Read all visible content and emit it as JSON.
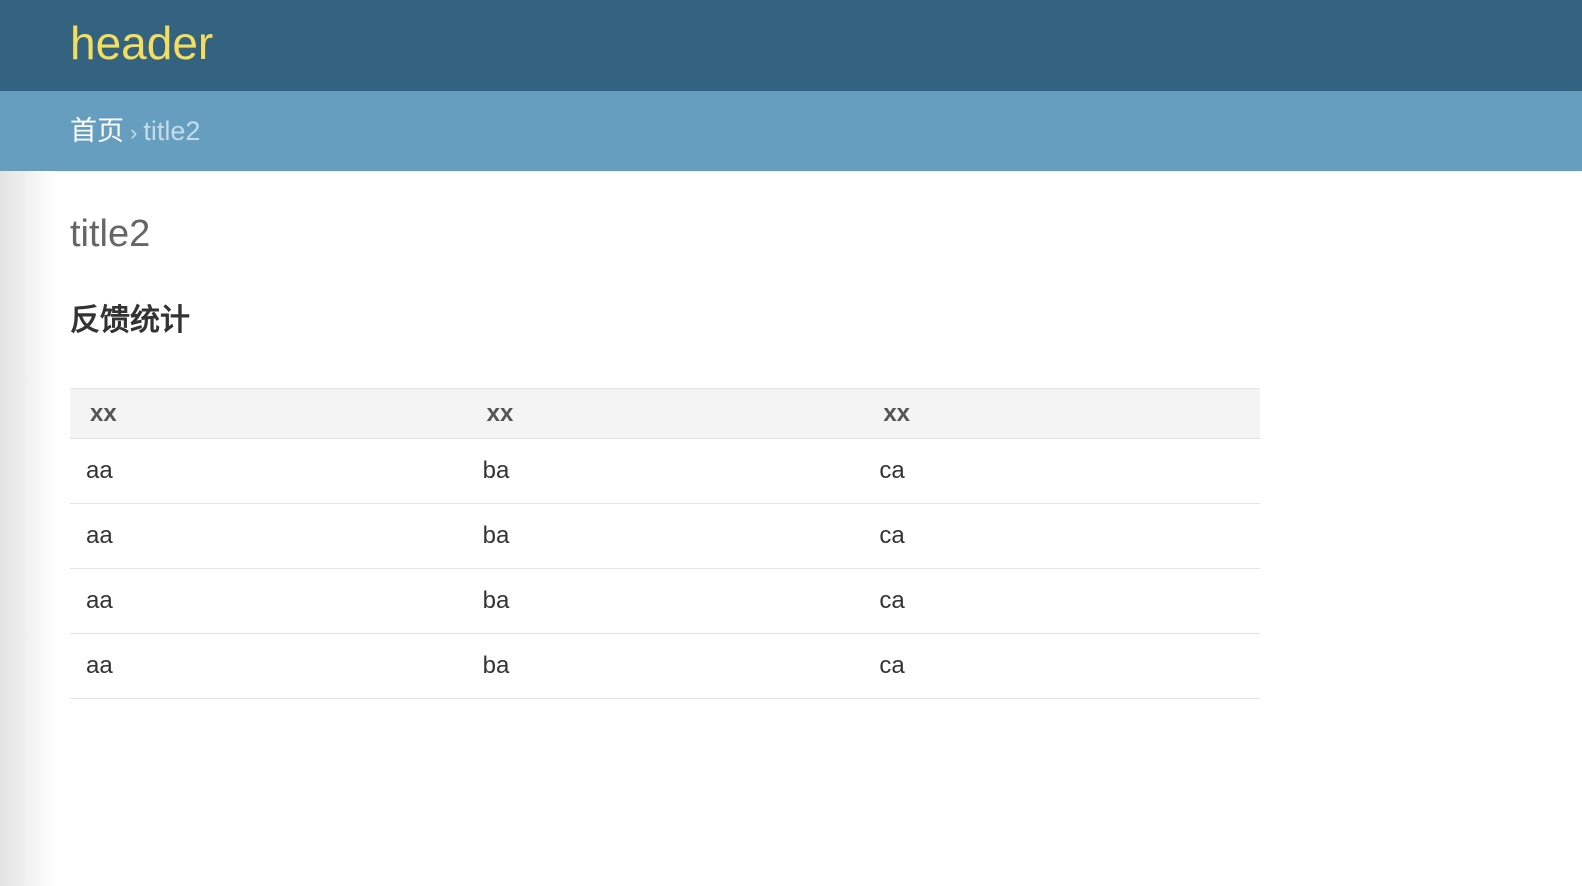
{
  "header": {
    "brand": "header",
    "brand_color": "#f5dd5d",
    "background_color": "#336380"
  },
  "breadcrumbs": {
    "home": "首页",
    "separator": "›",
    "current": "title2",
    "background_color": "#669ebf"
  },
  "content": {
    "page_title": "title2",
    "section_title": "反馈统计"
  },
  "table": {
    "columns": [
      "xx",
      "xx",
      "xx"
    ],
    "rows": [
      [
        "aa",
        "ba",
        "ca"
      ],
      [
        "aa",
        "ba",
        "ca"
      ],
      [
        "aa",
        "ba",
        "ca"
      ],
      [
        "aa",
        "ba",
        "ca"
      ]
    ]
  }
}
